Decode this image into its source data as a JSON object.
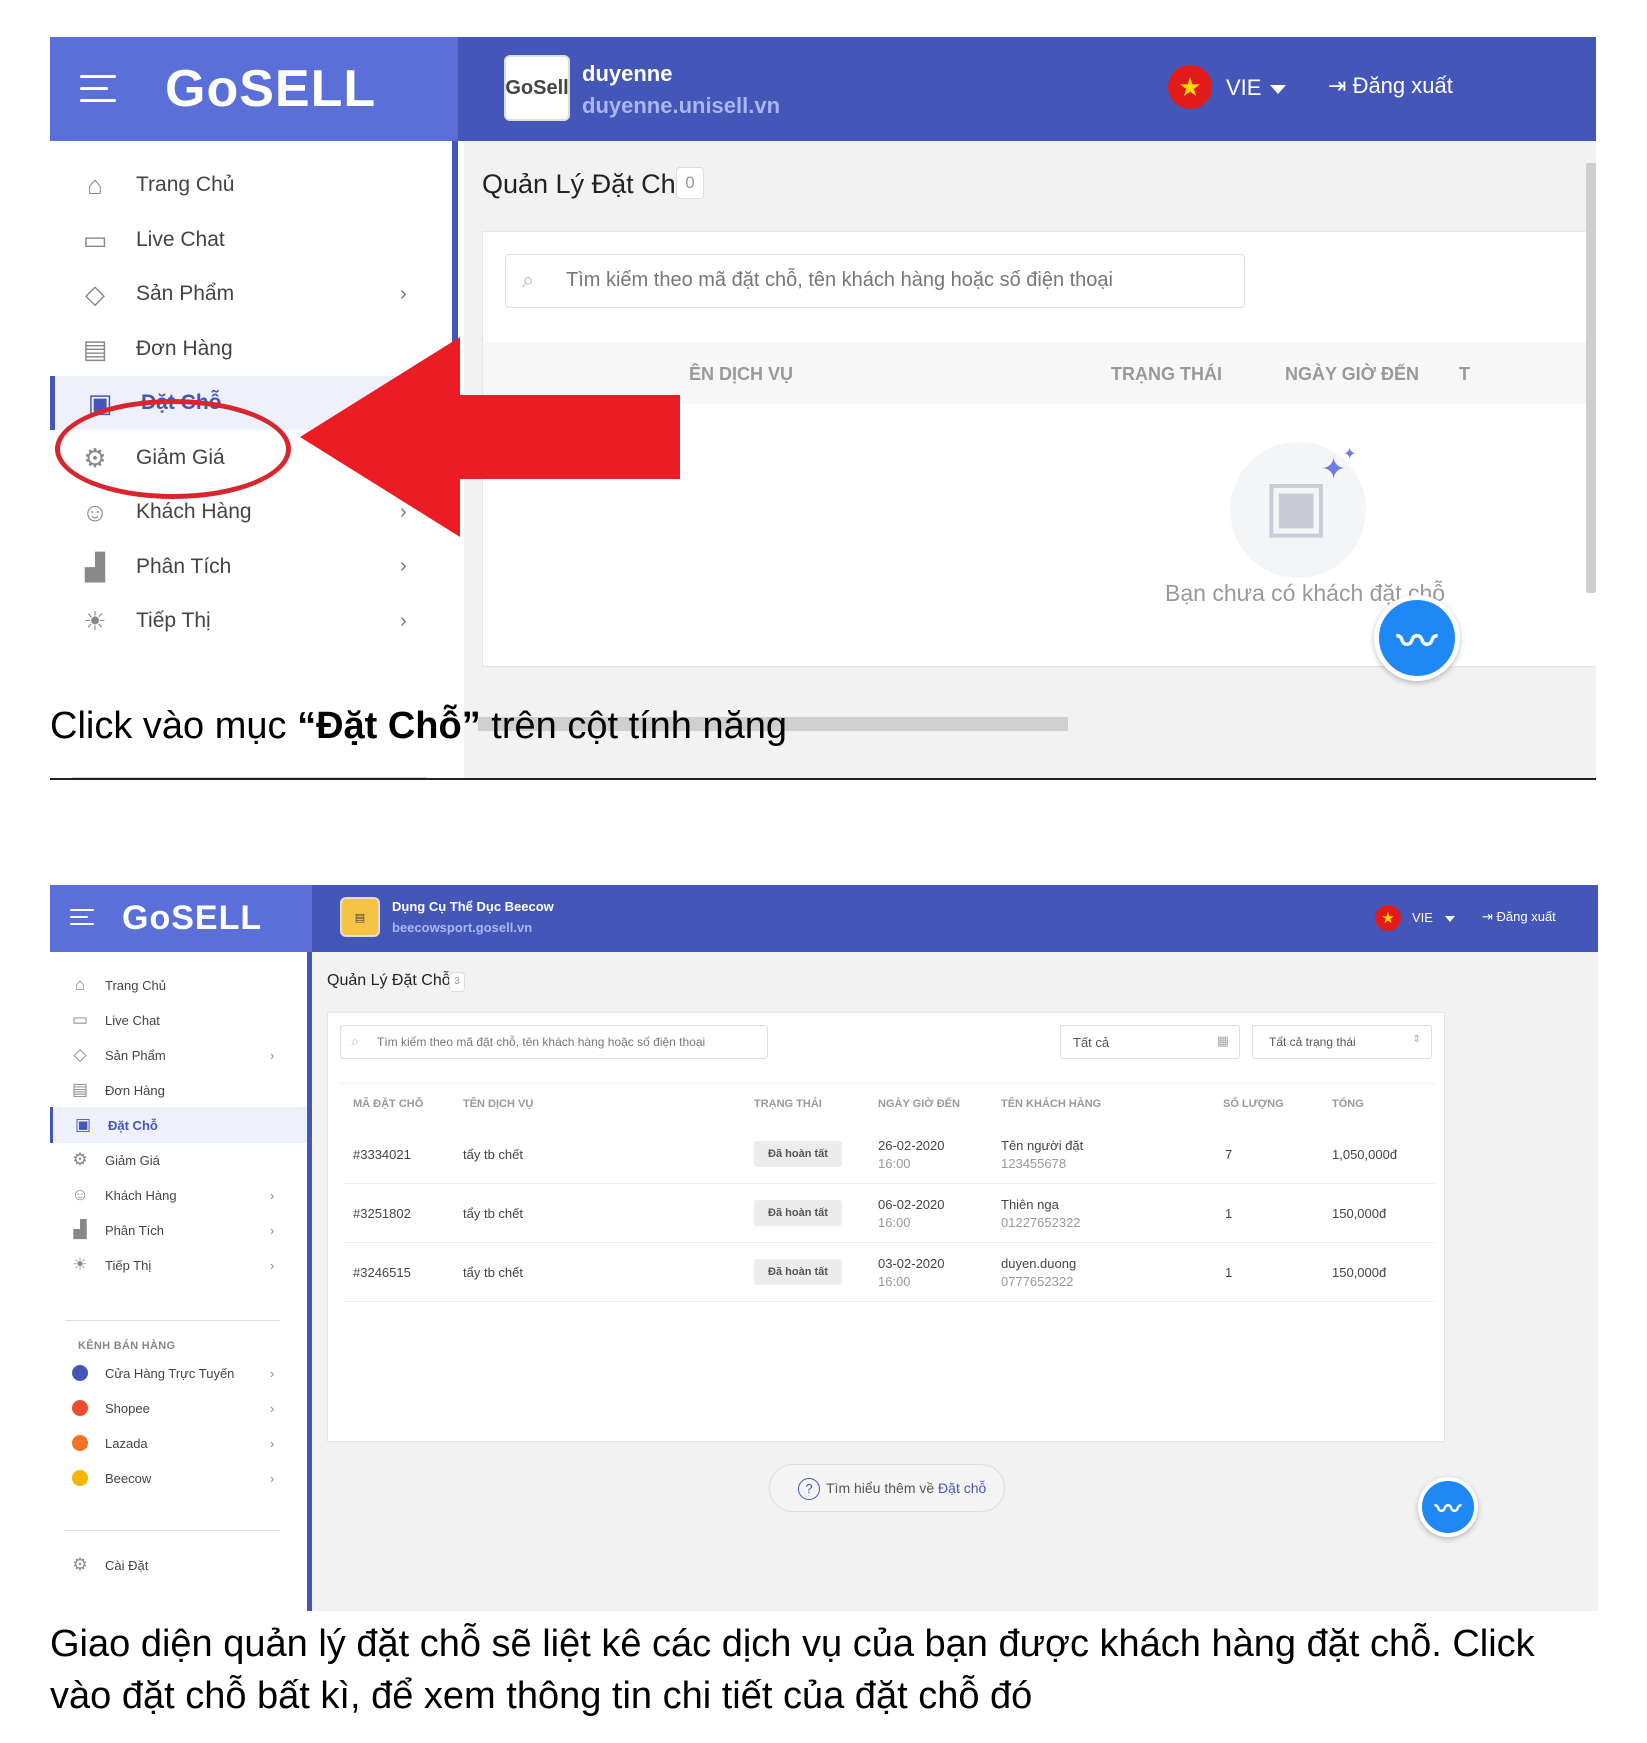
{
  "shot1": {
    "brand": "GoSELL",
    "shop_logo_text": "GoSell",
    "shop_name": "duyenne",
    "shop_url": "duyenne.unisell.vn",
    "lang": "VIE",
    "logout": "Đăng xuất",
    "nav": [
      {
        "label": "Trang Chủ",
        "icon": "home-icon",
        "chevron": false
      },
      {
        "label": "Live Chat",
        "icon": "chat-icon",
        "chevron": false
      },
      {
        "label": "Sản Phẩm",
        "icon": "tag-icon",
        "chevron": true
      },
      {
        "label": "Đơn Hàng",
        "icon": "receipt-icon",
        "chevron": false
      },
      {
        "label": "Đặt Chỗ",
        "icon": "calendar-icon",
        "chevron": false,
        "active": true
      },
      {
        "label": "Giảm Giá",
        "icon": "discount-icon",
        "chevron": false
      },
      {
        "label": "Khách Hàng",
        "icon": "users-icon",
        "chevron": true
      },
      {
        "label": "Phân Tích",
        "icon": "chart-icon",
        "chevron": true
      },
      {
        "label": "Tiếp Thị",
        "icon": "bulb-icon",
        "chevron": true
      }
    ],
    "page_title": "Quản Lý Đặt Chỗ",
    "count": "0",
    "search_placeholder": "Tìm kiếm theo mã đặt chỗ, tên khách hàng hoặc số điện thoại",
    "columns": [
      "ÊN DỊCH VỤ",
      "TRẠNG THÁI",
      "NGÀY GIỜ ĐẾN",
      "T"
    ],
    "empty_text": "Bạn chưa có khách đặt chỗ"
  },
  "caption1": {
    "prefix": "Click vào mục ",
    "bold": "“Đặt Chỗ”",
    "suffix": " trên cột tính năng"
  },
  "shot2": {
    "brand": "GoSELL",
    "shop_name": "Dụng Cụ Thể Dục Beecow",
    "shop_url": "beecowsport.gosell.vn",
    "lang": "VIE",
    "logout": "Đăng xuất",
    "nav": [
      {
        "label": "Trang Chủ",
        "icon": "home-icon",
        "chevron": false
      },
      {
        "label": "Live Chat",
        "icon": "chat-icon",
        "chevron": false
      },
      {
        "label": "Sản Phẩm",
        "icon": "tag-icon",
        "chevron": true
      },
      {
        "label": "Đơn Hàng",
        "icon": "receipt-icon",
        "chevron": false
      },
      {
        "label": "Đặt Chỗ",
        "icon": "calendar-icon",
        "chevron": false,
        "active": true
      },
      {
        "label": "Giảm Giá",
        "icon": "discount-icon",
        "chevron": false
      },
      {
        "label": "Khách Hàng",
        "icon": "users-icon",
        "chevron": true
      },
      {
        "label": "Phân Tích",
        "icon": "chart-icon",
        "chevron": true
      },
      {
        "label": "Tiếp Thị",
        "icon": "bulb-icon",
        "chevron": true
      }
    ],
    "channels_title": "KÊNH BÁN HÀNG",
    "channels": [
      {
        "label": "Cửa Hàng Trực Tuyến",
        "color": "#4456b8"
      },
      {
        "label": "Shopee",
        "color": "#ee4d2d"
      },
      {
        "label": "Lazada",
        "color": "#f57224"
      },
      {
        "label": "Beecow",
        "color": "#f5b400"
      }
    ],
    "settings": "Cài Đặt",
    "page_title": "Quản Lý Đặt Chỗ",
    "count": "3",
    "search_placeholder": "Tìm kiếm theo mã đặt chỗ, tên khách hàng hoặc số điện thoại",
    "date_filter": "Tất cả",
    "status_filter": "Tất cả trạng thái",
    "columns": [
      "MÃ ĐẶT CHỖ",
      "TÊN DỊCH VỤ",
      "TRẠNG THÁI",
      "NGÀY GIỜ ĐẾN",
      "TÊN KHÁCH HÀNG",
      "SỐ LƯỢNG",
      "TỔNG"
    ],
    "rows": [
      {
        "id": "#3334021",
        "service": "tẩy tb chết",
        "status": "Đã hoàn tất",
        "date": "26-02-2020",
        "time": "16:00",
        "customer": "Tên người đặt",
        "phone": "123455678",
        "qty": "7",
        "total": "1,050,000đ"
      },
      {
        "id": "#3251802",
        "service": "tẩy tb chết",
        "status": "Đã hoàn tất",
        "date": "06-02-2020",
        "time": "16:00",
        "customer": "Thiên nga",
        "phone": "01227652322",
        "qty": "1",
        "total": "150,000đ"
      },
      {
        "id": "#3246515",
        "service": "tẩy tb chết",
        "status": "Đã hoàn tất",
        "date": "03-02-2020",
        "time": "16:00",
        "customer": "duyen.duong",
        "phone": "0777652322",
        "qty": "1",
        "total": "150,000đ"
      }
    ],
    "learn_prefix": "Tìm hiểu thêm về ",
    "learn_link": "Đặt chỗ"
  },
  "caption2": {
    "line1": "Giao diện quản lý đặt chỗ sẽ liệt kê các dịch vụ của bạn được khách hàng đặt chỗ. Click",
    "line2": "vào đặt chỗ bất kì, để xem thông tin chi tiết của đặt chỗ đó"
  },
  "colors": {
    "header": "#4456b8",
    "logo_bg": "#5a6fd8",
    "highlight": "#d8262f",
    "messenger": "#1e88f5"
  }
}
